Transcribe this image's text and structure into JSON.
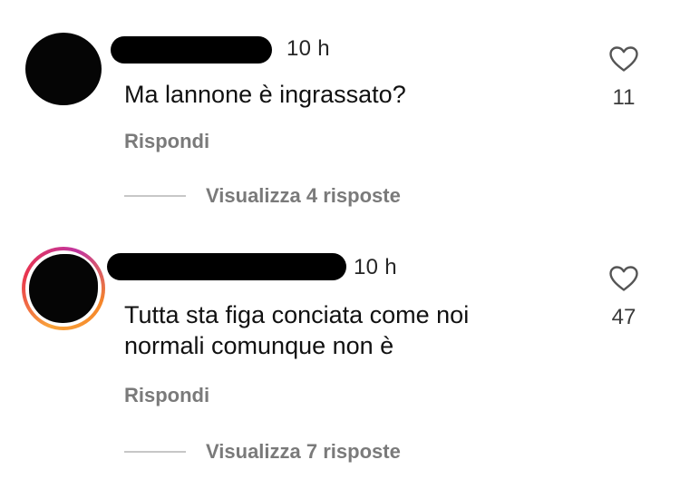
{
  "comments": [
    {
      "time": "10 h",
      "text": "Ma lannone è ingrassato?",
      "reply_label": "Rispondi",
      "view_replies": "Visualizza 4 risposte",
      "likes": "11",
      "like_icon": "heart-outline-icon",
      "avatar_story_ring": false
    },
    {
      "time": "10 h",
      "text": "Tutta sta figa conciata come noi\nnormali comunque non è",
      "reply_label": "Rispondi",
      "view_replies": "Visualizza 7 risposte",
      "likes": "47",
      "like_icon": "heart-outline-icon",
      "avatar_story_ring": true
    }
  ],
  "colors": {
    "text_primary": "#111111",
    "text_secondary": "#7a7a7a",
    "divider": "#c7c7c7",
    "story_ring": [
      "#f9a33a",
      "#e8344e",
      "#c1359f"
    ]
  }
}
